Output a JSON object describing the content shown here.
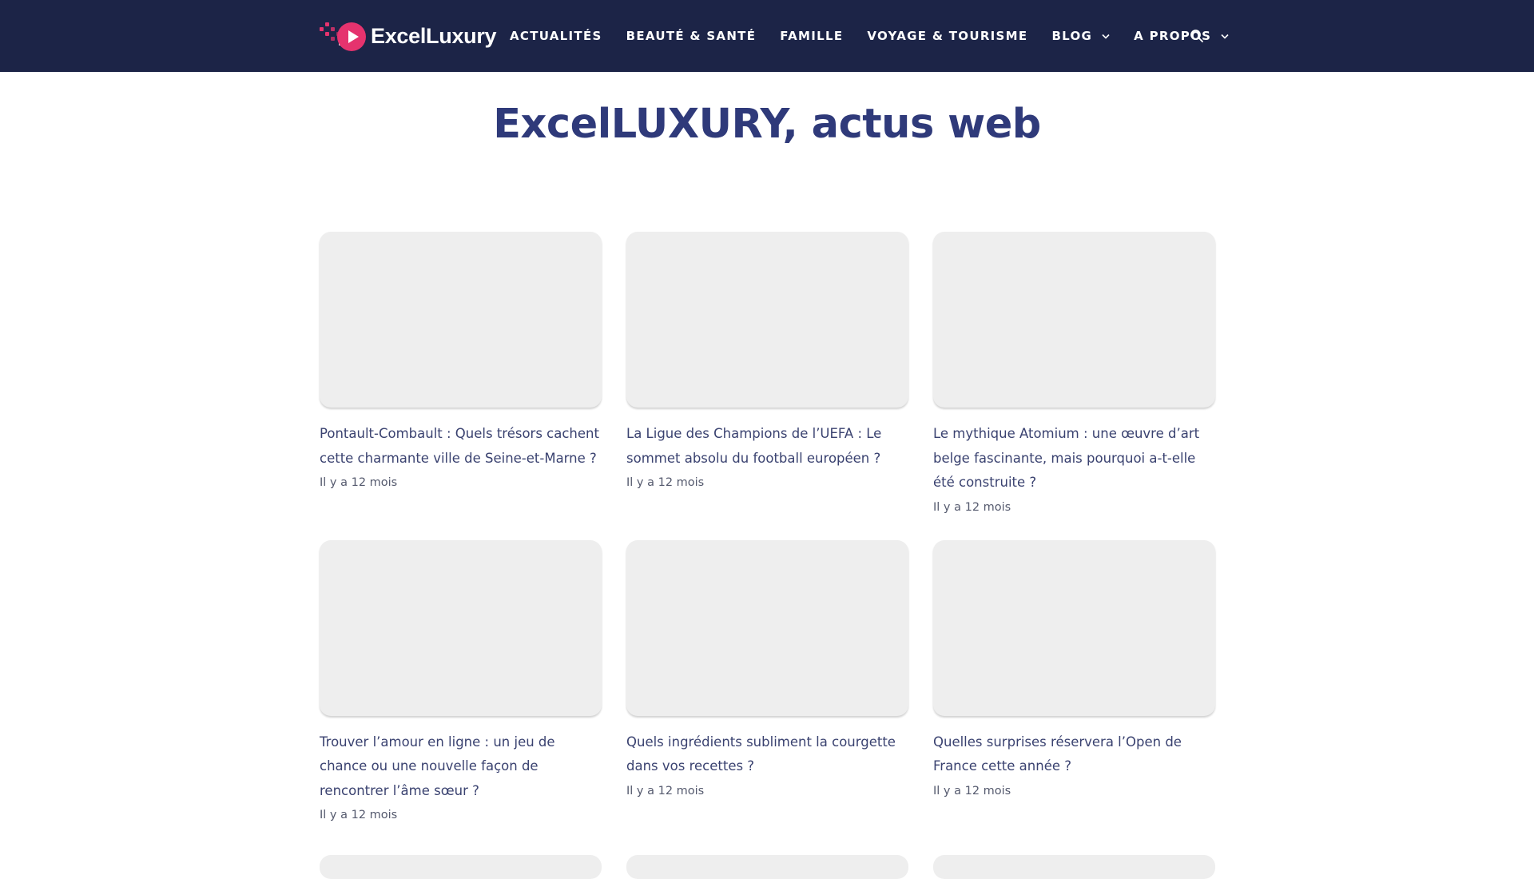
{
  "header": {
    "logo_text": "ExcelLuxury",
    "logo_color": "#e5336e",
    "background": "#1c2447",
    "nav": [
      {
        "label": "ACTUALITÉS",
        "has_dropdown": false
      },
      {
        "label": "BEAUTÉ & SANTÉ",
        "has_dropdown": false
      },
      {
        "label": "FAMILLE",
        "has_dropdown": false
      },
      {
        "label": "VOYAGE & TOURISME",
        "has_dropdown": false
      },
      {
        "label": "BLOG",
        "has_dropdown": true
      },
      {
        "label": "A PROPOS",
        "has_dropdown": true
      }
    ],
    "search_icon": "search-icon"
  },
  "main": {
    "title": "ExcelLUXURY, actus web",
    "title_color": "#2f3a7a",
    "posts": [
      {
        "title": "Pontault-Combault : Quels trésors cachent cette charmante ville de Seine-et-Marne ?",
        "date": "Il y a 12 mois"
      },
      {
        "title": "La Ligue des Champions de l’UEFA : Le sommet absolu du football européen ?",
        "date": "Il y a 12 mois"
      },
      {
        "title": "Le mythique Atomium : une œuvre d’art belge fascinante, mais pourquoi a-t-elle été construite ?",
        "date": "Il y a 12 mois"
      },
      {
        "title": "Trouver l’amour en ligne : un jeu de chance ou une nouvelle façon de rencontrer l’âme sœur ?",
        "date": "Il y a 12 mois"
      },
      {
        "title": "Quels ingrédients subliment la courgette dans vos recettes ?",
        "date": "Il y a 12 mois"
      },
      {
        "title": "Quelles surprises réservera l’Open de France cette année ?",
        "date": "Il y a 12 mois"
      }
    ]
  }
}
